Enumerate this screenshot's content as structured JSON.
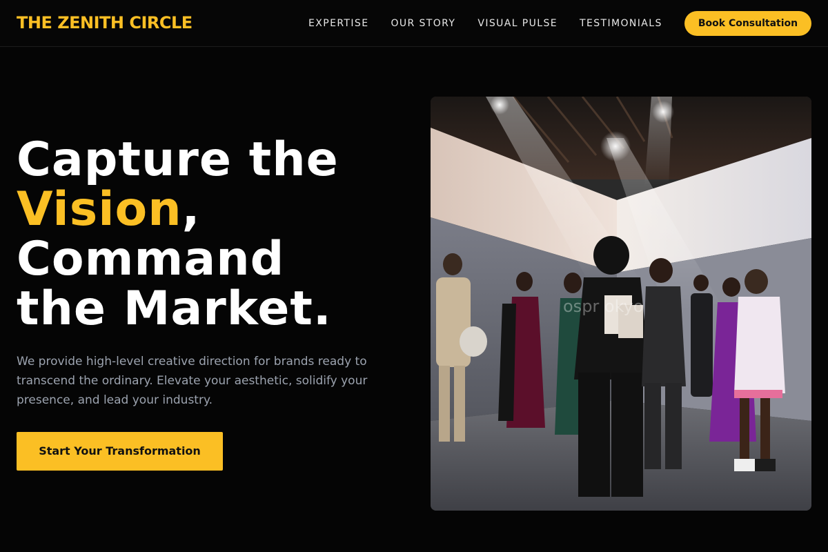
{
  "header": {
    "brand": "THE ZENITH CIRCLE",
    "nav": [
      {
        "label": "EXPERTISE"
      },
      {
        "label": "OUR STORY"
      },
      {
        "label": "VISUAL PULSE"
      },
      {
        "label": "TESTIMONIALS"
      }
    ],
    "cta_label": "Book Consultation"
  },
  "hero": {
    "headline_1": "Capture the",
    "headline_accent": "Vision",
    "headline_comma": ",",
    "headline_2": "Command",
    "headline_3": "the Market.",
    "description": "We provide high-level creative direction for brands ready to transcend the ordinary. Elevate your aesthetic, solidify your presence, and lead your industry.",
    "button_label": "Start Your Transformation",
    "image": {
      "watermark_text": "ospr      okyo"
    }
  },
  "colors": {
    "accent": "#fbbf24",
    "background": "#050505",
    "muted_text": "#9ca3af"
  }
}
